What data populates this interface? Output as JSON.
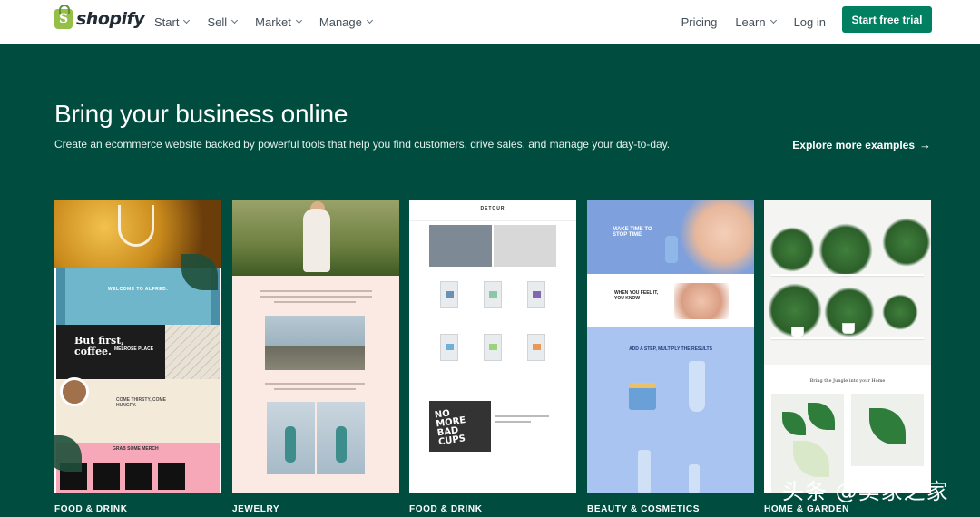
{
  "header": {
    "logo_text": "shopify",
    "nav_left": [
      {
        "label": "Start",
        "has_dropdown": true
      },
      {
        "label": "Sell",
        "has_dropdown": true
      },
      {
        "label": "Market",
        "has_dropdown": true
      },
      {
        "label": "Manage",
        "has_dropdown": true
      }
    ],
    "nav_right": [
      {
        "label": "Pricing",
        "has_dropdown": false
      },
      {
        "label": "Learn",
        "has_dropdown": true
      },
      {
        "label": "Log in",
        "has_dropdown": false
      }
    ],
    "cta_label": "Start free trial"
  },
  "hero": {
    "title": "Bring your business online",
    "subtitle": "Create an ecommerce website backed by powerful tools that help you find customers, drive sales, and manage your day-to-day.",
    "explore_label": "Explore more examples",
    "explore_icon": "arrow-right-icon"
  },
  "cards": [
    {
      "category": "FOOD & DRINK",
      "snippets": [
        "WELCOME TO ALFRED.",
        "But first, coffee.",
        "MELROSE PLACE",
        "COME THIRSTY, COME HUNGRY.",
        "GRAB SOME MERCH"
      ]
    },
    {
      "category": "JEWELRY"
    },
    {
      "category": "FOOD & DRINK",
      "snippets": [
        "DETOUR",
        "NO MORE BAD CUPS"
      ]
    },
    {
      "category": "BEAUTY & COSMETICS",
      "snippets": [
        "MAKE TIME TO STOP TIME",
        "WHEN YOU FEEL IT, YOU KNOW",
        "ADD A STEP, MULTIPLY THE RESULTS"
      ]
    },
    {
      "category": "HOME & GARDEN",
      "snippets": [
        "Bring the Jungle into your Home"
      ]
    }
  ],
  "watermark": "头条 @卖家之家",
  "colors": {
    "hero_bg": "#004c3f",
    "cta_bg": "#008060",
    "logo_green": "#95bf47",
    "header_bg": "#ffffff"
  }
}
